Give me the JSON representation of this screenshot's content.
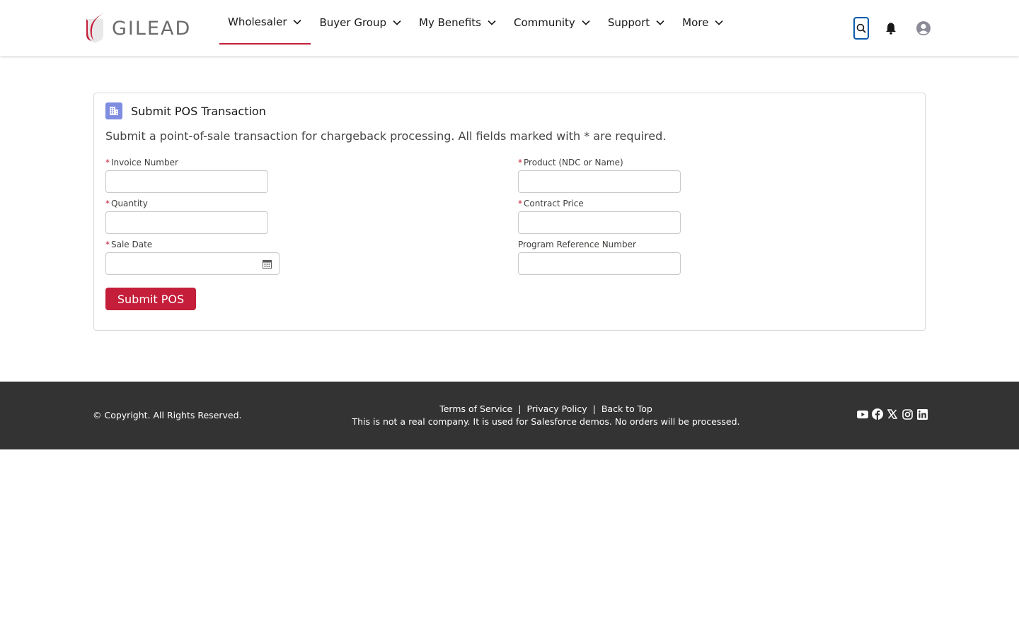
{
  "header": {
    "logo_text": "GILEAD",
    "nav": [
      {
        "label": "Wholesaler",
        "active": true
      },
      {
        "label": "Buyer Group",
        "active": false
      },
      {
        "label": "My Benefits",
        "active": false
      },
      {
        "label": "Community",
        "active": false
      },
      {
        "label": "Support",
        "active": false
      },
      {
        "label": "More",
        "active": false
      }
    ],
    "icons": [
      "search-icon",
      "bell-icon",
      "user-avatar-icon"
    ]
  },
  "card": {
    "title": "Submit POS Transaction",
    "icon": "building-icon",
    "description": "Submit a point-of-sale transaction for chargeback processing. All fields marked with * are required.",
    "fields": {
      "invoice_number": {
        "label": "Invoice Number",
        "required": true,
        "value": ""
      },
      "product": {
        "label": "Product (NDC or Name)",
        "required": true,
        "value": ""
      },
      "quantity": {
        "label": "Quantity",
        "required": true,
        "value": ""
      },
      "contract_price": {
        "label": "Contract Price",
        "required": true,
        "value": ""
      },
      "sale_date": {
        "label": "Sale Date",
        "required": true,
        "value": ""
      },
      "program_reference": {
        "label": "Program Reference Number",
        "required": false,
        "value": ""
      }
    },
    "required_marker": "*",
    "submit_label": "Submit POS"
  },
  "footer": {
    "copyright": "© Copyright. All Rights Reserved.",
    "links": [
      "Terms of Service",
      "Privacy Policy",
      "Back to Top"
    ],
    "separator": "|",
    "disclaimer": "This is not a real company. It is used for Salesforce demos. No orders will be processed.",
    "social": [
      "youtube-icon",
      "facebook-icon",
      "x-twitter-icon",
      "instagram-icon",
      "linkedin-icon"
    ]
  },
  "colors": {
    "brand_red": "#c41e3a",
    "focus_blue": "#0b5cab",
    "footer_bg": "#333333",
    "card_icon_bg": "#7f8de1"
  }
}
